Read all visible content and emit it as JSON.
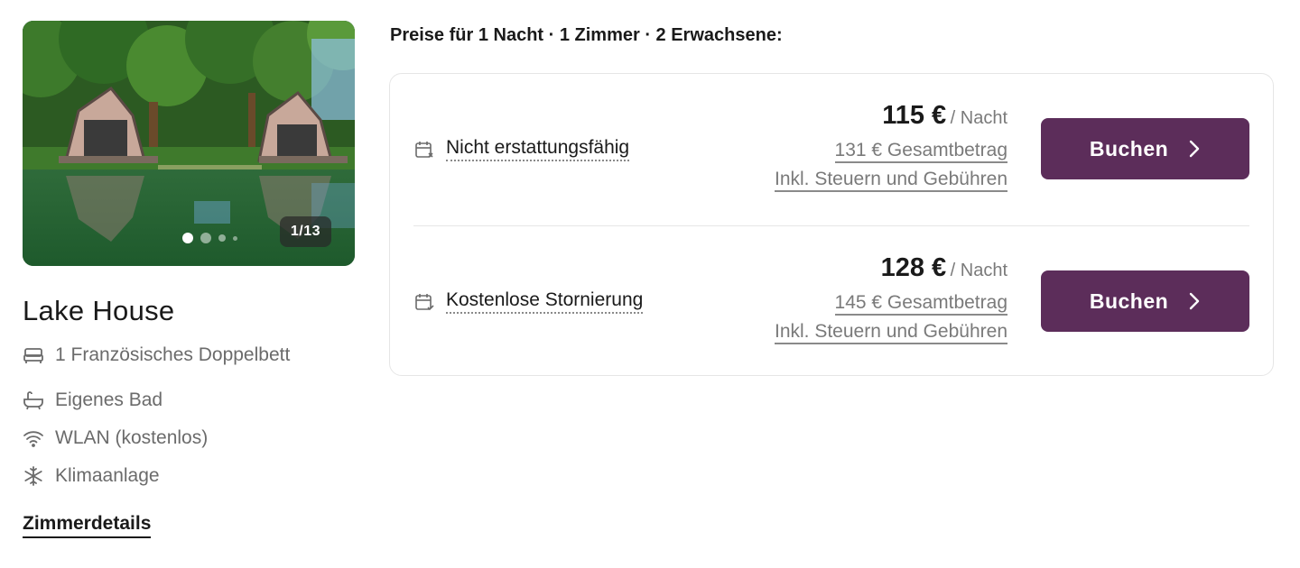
{
  "room": {
    "title": "Lake House",
    "photo_counter": "1/13",
    "features": [
      {
        "icon": "bed-icon",
        "label": "1 Französisches Doppelbett"
      },
      {
        "icon": "bathtub-icon",
        "label": "Eigenes Bad"
      },
      {
        "icon": "wifi-icon",
        "label": "WLAN (kostenlos)"
      },
      {
        "icon": "snowflake-icon",
        "label": "Klimaanlage"
      }
    ],
    "details_link": "Zimmerdetails"
  },
  "pricing": {
    "heading": "Preise für 1 Nacht · 1 Zimmer · 2 Erwachsene:",
    "rates": [
      {
        "policy": "Nicht erstattungsfähig",
        "policy_icon": "calendar-x-icon",
        "price": "115 €",
        "per_night": "/ Nacht",
        "total": "131 € Gesamtbetrag",
        "taxes": "Inkl. Steuern und Gebühren",
        "button": "Buchen"
      },
      {
        "policy": "Kostenlose Stornierung",
        "policy_icon": "calendar-check-icon",
        "price": "128 €",
        "per_night": "/ Nacht",
        "total": "145 € Gesamtbetrag",
        "taxes": "Inkl. Steuern und Gebühren",
        "button": "Buchen"
      }
    ]
  },
  "colors": {
    "accent": "#5c2d5a",
    "text": "#1a1a1a",
    "muted": "#6b6b6b",
    "border": "#e6e6e6"
  }
}
